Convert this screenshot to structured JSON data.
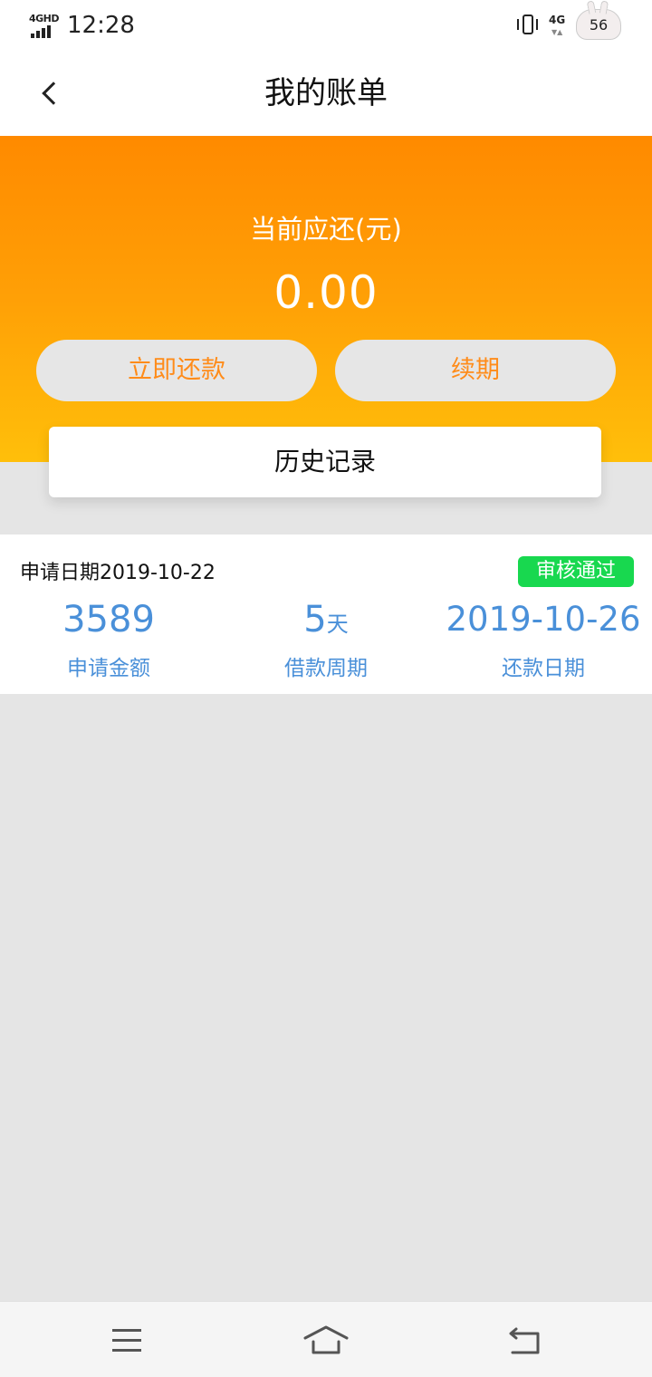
{
  "status_bar": {
    "network_left": "4GHD",
    "time": "12:28",
    "network_right": "4G",
    "battery": "56"
  },
  "header": {
    "title": "我的账单"
  },
  "summary": {
    "label": "当前应还(元)",
    "amount": "0.00",
    "repay_button": "立即还款",
    "renew_button": "续期",
    "history_button": "历史记录"
  },
  "bill": {
    "apply_date": "申请日期2019-10-22",
    "status": "审核通过",
    "amount_value": "3589",
    "amount_label": "申请金额",
    "period_value": "5",
    "period_unit": "天",
    "period_label": "借款周期",
    "due_value": "2019-10-26",
    "due_label": "还款日期"
  },
  "icons": {
    "back": "chevron-left-icon",
    "menu": "menu-icon",
    "home": "home-icon",
    "return": "return-icon"
  },
  "colors": {
    "accent_orange": "#ff8a00",
    "button_text": "#ff8c1a",
    "stat_blue": "#4a90d9",
    "status_green": "#18d84f"
  }
}
